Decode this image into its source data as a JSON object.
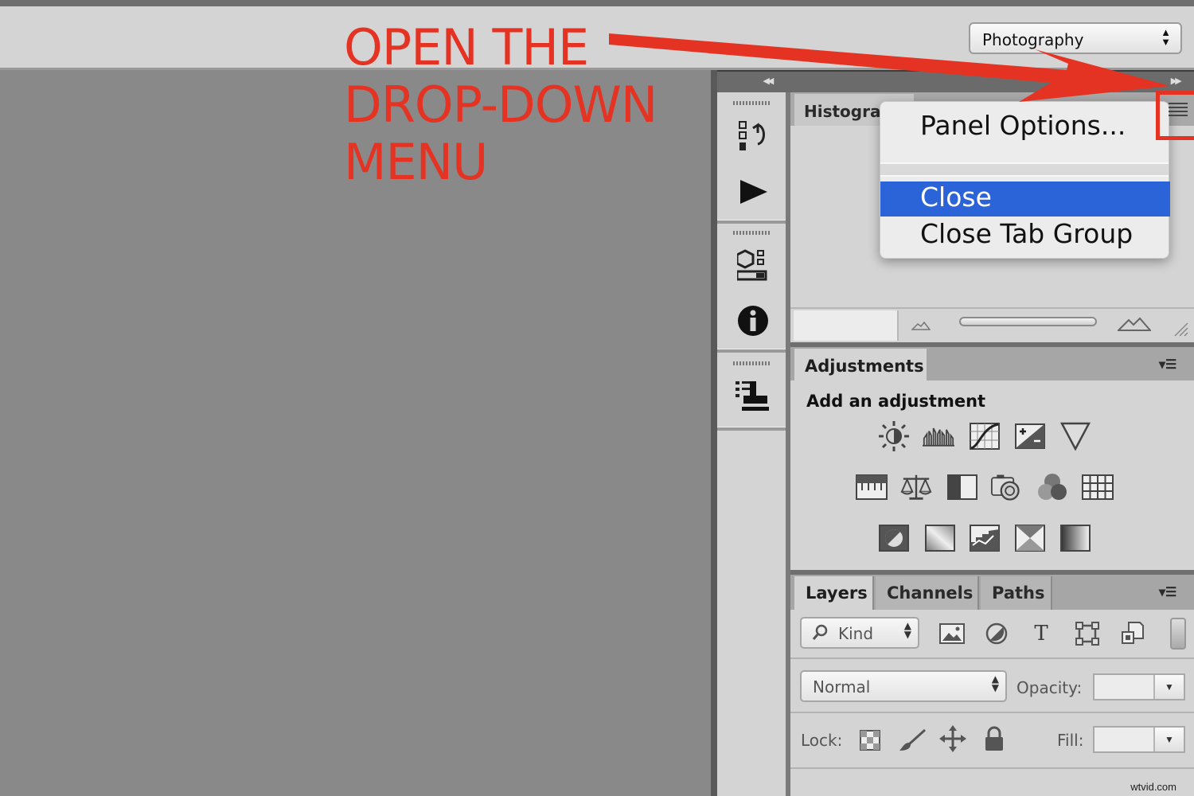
{
  "workspace": {
    "selected": "Photography",
    "arrows": "⬍"
  },
  "annotation": {
    "line1": "OPEN THE",
    "line2": "DROP-DOWN",
    "line3": "MENU"
  },
  "dock": {
    "collapse_left": "◂◂",
    "collapse_right": "▸▸"
  },
  "histogram": {
    "tab_label": "Histogra"
  },
  "flyout_menu": {
    "items": [
      {
        "label": "Panel Options..."
      },
      {
        "label": "Close",
        "highlighted": true
      },
      {
        "label": "Close Tab Group"
      }
    ],
    "highlight_color": "#2b63d9"
  },
  "adjustments": {
    "tab_label": "Adjustments",
    "heading": "Add an adjustment",
    "icons_row1": [
      "brightness-contrast-icon",
      "levels-icon",
      "curves-icon",
      "exposure-icon",
      "vibrance-icon"
    ],
    "icons_row2": [
      "hue-saturation-icon",
      "color-balance-icon",
      "black-white-icon",
      "photo-filter-icon",
      "channel-mixer-icon",
      "color-lookup-icon"
    ],
    "icons_row3": [
      "invert-icon",
      "posterize-icon",
      "threshold-icon",
      "selective-color-icon",
      "gradient-map-icon"
    ]
  },
  "layers": {
    "tabs": [
      "Layers",
      "Channels",
      "Paths"
    ],
    "filter_kind": "Kind",
    "blend_mode": "Normal",
    "opacity_label": "Opacity:",
    "lock_label": "Lock:",
    "fill_label": "Fill:"
  },
  "annotation_color": "#e53323",
  "watermark": "wtvid.com"
}
